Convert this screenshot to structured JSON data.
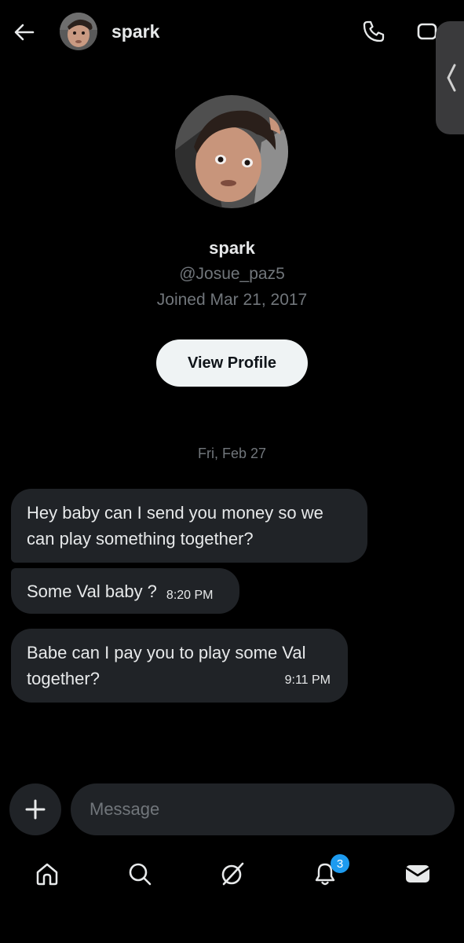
{
  "header": {
    "name": "spark",
    "back_icon": "arrow-left-icon",
    "call_icon": "phone-icon",
    "video_icon": "video-icon",
    "edge_panel_icon": "chevron-left-icon"
  },
  "profile": {
    "name": "spark",
    "handle": "@Josue_paz5",
    "joined": "Joined Mar 21, 2017",
    "view_profile_label": "View Profile"
  },
  "conversation": {
    "date_separator": "Fri, Feb 27",
    "messages": [
      {
        "text": "Hey baby can I send you money so we can play something together?",
        "time": ""
      },
      {
        "text": "Some Val baby ?",
        "time": "8:20 PM"
      },
      {
        "text": "Babe can I pay you to play some Val together?",
        "time": "9:11 PM"
      }
    ]
  },
  "composer": {
    "placeholder": "Message",
    "add_icon": "plus-icon"
  },
  "nav": {
    "items": [
      {
        "name": "home",
        "icon": "home-icon"
      },
      {
        "name": "search",
        "icon": "search-icon"
      },
      {
        "name": "grok",
        "icon": "grok-icon"
      },
      {
        "name": "notifications",
        "icon": "bell-icon",
        "badge": "3"
      },
      {
        "name": "messages",
        "icon": "mail-icon"
      }
    ]
  },
  "colors": {
    "background": "#000000",
    "bubble": "#202327",
    "muted_text": "#71767b",
    "badge": "#1d9bf0",
    "button": "#eff3f4"
  }
}
